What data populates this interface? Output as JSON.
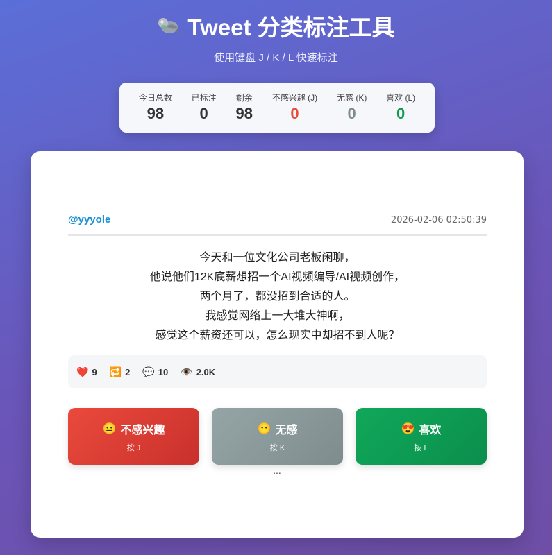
{
  "header": {
    "title_icon": "pigeon-icon",
    "title": "Tweet 分类标注工具",
    "subtitle": "使用键盘 J / K / L 快速标注"
  },
  "stats": [
    {
      "label": "今日总数",
      "value": "98"
    },
    {
      "label": "已标注",
      "value": "0"
    },
    {
      "label": "剩余",
      "value": "98"
    },
    {
      "label": "不感兴趣 (J)",
      "value": "0"
    },
    {
      "label": "无感 (K)",
      "value": "0"
    },
    {
      "label": "喜欢 (L)",
      "value": "0"
    }
  ],
  "tweet": {
    "author": "@yyyole",
    "timestamp": "2026-02-06 02:50:39",
    "lines": [
      "今天和一位文化公司老板闲聊，",
      "他说他们12K底薪想招一个AI视频编导/AI视频创作，",
      "两个月了，都没招到合适的人。",
      "我感觉网络上一大堆大神啊，",
      "感觉这个薪资还可以，怎么现实中却招不到人呢？"
    ],
    "metrics": {
      "likes": {
        "icon": "heart-icon",
        "glyph": "❤️",
        "value": "9"
      },
      "retweets": {
        "icon": "retweet-icon",
        "glyph": "🔁",
        "value": "2"
      },
      "replies": {
        "icon": "speech-bubble-icon",
        "glyph": "💬",
        "value": "10"
      },
      "views": {
        "icon": "eye-icon",
        "glyph": "👁️",
        "value": "2.0K"
      }
    }
  },
  "actions": {
    "not_interested": {
      "emoji": "😐",
      "label": "不感兴趣",
      "hint": "按 J",
      "color": "#e74c3c"
    },
    "neutral": {
      "emoji": "😶",
      "label": "无感",
      "hint": "按 K",
      "color": "#95a5a6"
    },
    "like": {
      "emoji": "😍",
      "label": "喜欢",
      "hint": "按 L",
      "color": "#0f9b4f"
    }
  },
  "loading_text": "..."
}
